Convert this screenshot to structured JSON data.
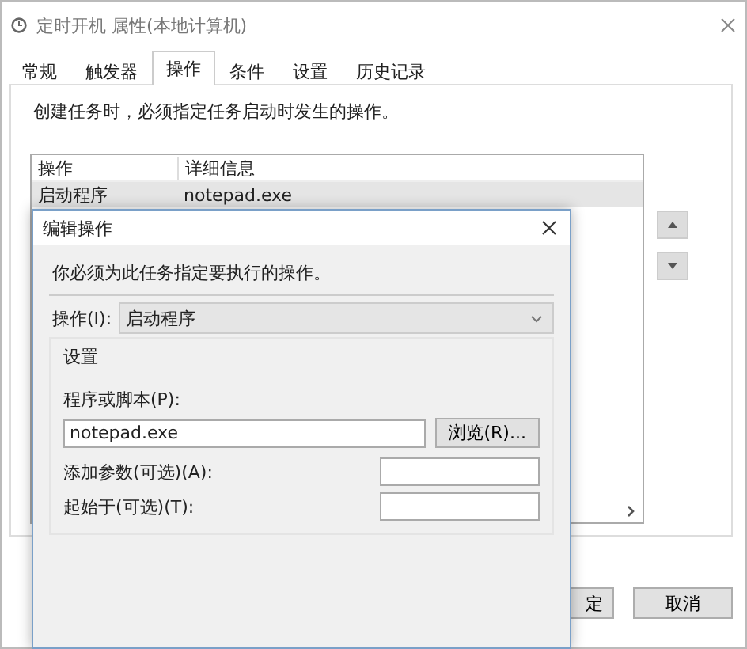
{
  "window": {
    "title": "定时开机 属性(本地计算机)"
  },
  "tabs": [
    {
      "label": "常规",
      "selected": false
    },
    {
      "label": "触发器",
      "selected": false
    },
    {
      "label": "操作",
      "selected": true
    },
    {
      "label": "条件",
      "selected": false
    },
    {
      "label": "设置",
      "selected": false
    },
    {
      "label": "历史记录",
      "selected": false
    }
  ],
  "description": "创建任务时，必须指定任务启动时发生的操作。",
  "actions_table": {
    "columns": [
      "操作",
      "详细信息"
    ],
    "rows": [
      {
        "cells": [
          "启动程序",
          "notepad.exe"
        ],
        "selected": true
      }
    ]
  },
  "buttons": [
    {
      "label": "定"
    },
    {
      "label": "取消"
    }
  ],
  "dialog": {
    "title": "编辑操作",
    "instruction": "你必须为此任务指定要执行的操作。",
    "action": {
      "label": "操作(I):",
      "value": "启动程序"
    },
    "group": {
      "title": "设置",
      "program": {
        "label": "程序或脚本(P):",
        "value": "notepad.exe",
        "browse": "浏览(R)..."
      },
      "arguments": {
        "label": "添加参数(可选)(A):"
      },
      "start_in": {
        "label": "起始于(可选)(T):"
      }
    }
  }
}
